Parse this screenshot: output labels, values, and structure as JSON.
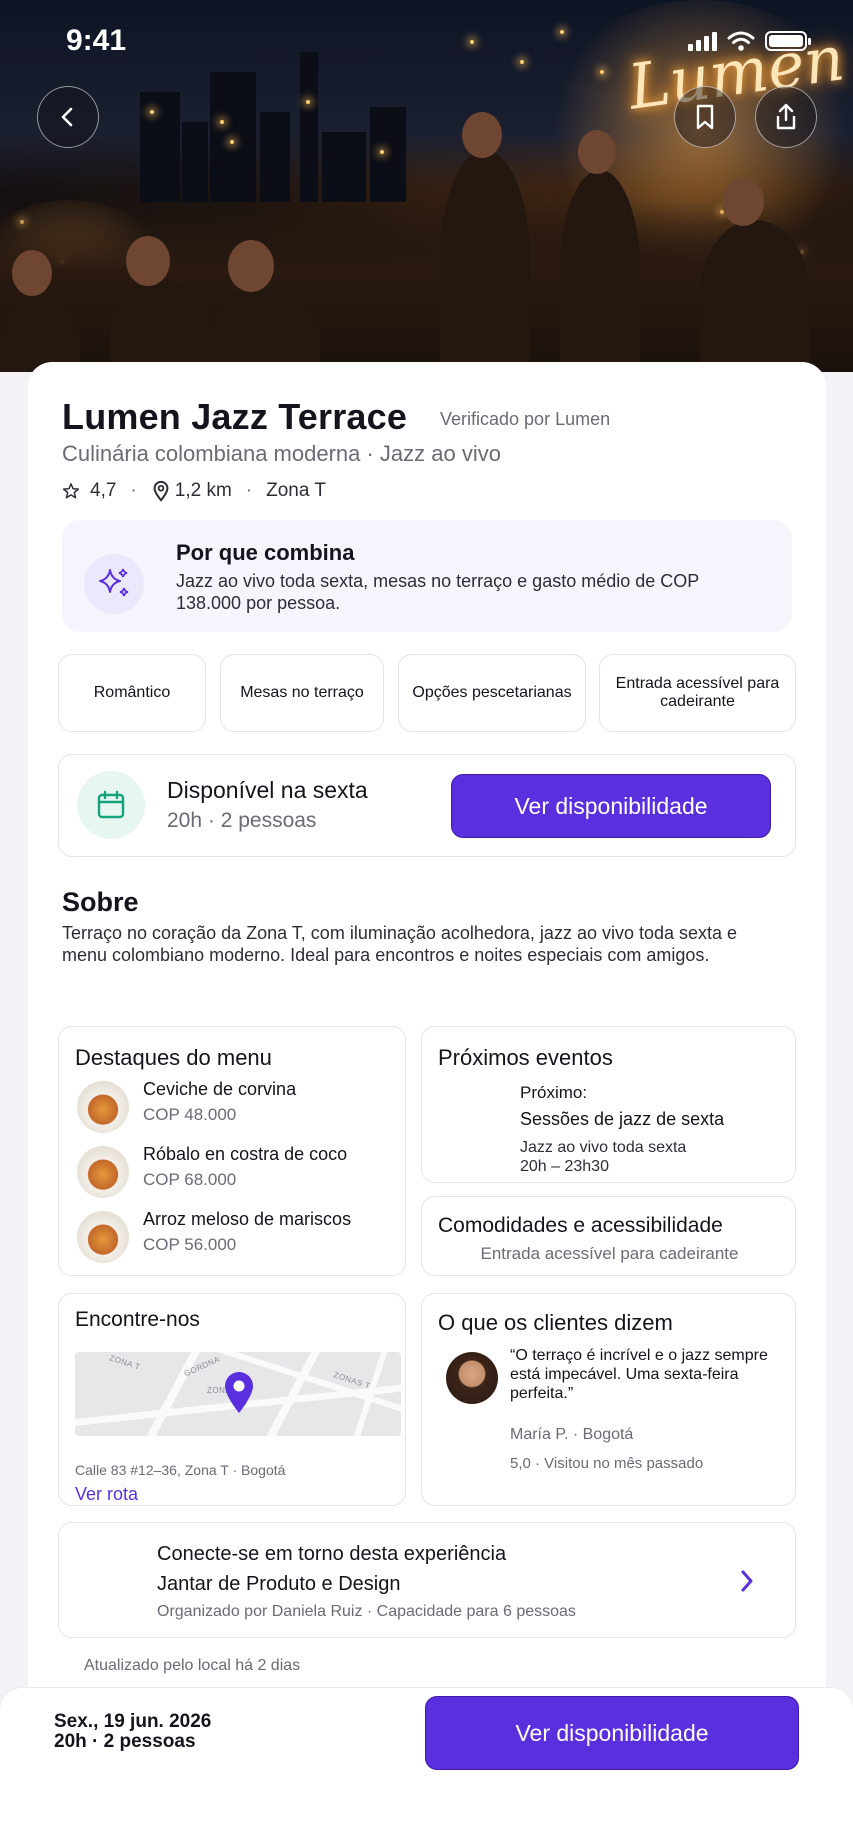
{
  "status": {
    "time": "9:41"
  },
  "hero": {
    "sign_text": "Lumen"
  },
  "venue": {
    "name": "Lumen Jazz Terrace",
    "verified": "Verificado por Lumen",
    "subtitle": "Culinária colombiana moderna · Jazz ao vivo",
    "rating": "4,7",
    "distance": "1,2 km",
    "area": "Zona T"
  },
  "why": {
    "title": "Por que combina",
    "text": "Jazz ao vivo toda sexta, mesas no terraço e gasto médio de COP 138.000 por pessoa."
  },
  "chips": [
    "Romântico",
    "Mesas no terraço",
    "Opções pescetarianas",
    "Entrada acessível para cadeirante"
  ],
  "availability": {
    "title": "Disponível na sexta",
    "subtitle": "20h · 2 pessoas",
    "button": "Ver disponibilidade"
  },
  "about": {
    "heading": "Sobre",
    "text": "Terraço no coração da Zona T, com iluminação acolhedora, jazz ao vivo toda sexta e menu colombiano moderno. Ideal para encontros e noites especiais com amigos."
  },
  "menu": {
    "heading": "Destaques do menu",
    "items": [
      {
        "name": "Ceviche de corvina",
        "price": "COP 48.000"
      },
      {
        "name": "Róbalo en costra de coco",
        "price": "COP 68.000"
      },
      {
        "name": "Arroz meloso de mariscos",
        "price": "COP 56.000"
      }
    ]
  },
  "events": {
    "heading": "Próximos eventos",
    "label": "Próximo:",
    "name": "Sessões de jazz de sexta",
    "desc": "Jazz ao vivo toda sexta",
    "time": "20h – 23h30"
  },
  "amenities": {
    "heading": "Comodidades e acessibilidade",
    "text": "Entrada acessível para cadeirante"
  },
  "find": {
    "heading": "Encontre-nos",
    "streets": [
      "ZONA T",
      "GORDNA",
      "ZONA T",
      "ZONAS T"
    ],
    "address": "Calle 83 #12–36, Zona T · Bogotá",
    "link": "Ver rota"
  },
  "reviews": {
    "heading": "O que os clientes dizem",
    "quote": "“O terraço é incrível e o jazz sempre está impecável. Uma sexta-feira perfeita.”",
    "author": "María P. · Bogotá",
    "meta": "5,0 · Visitou no mês passado"
  },
  "connect": {
    "title": "Conecte-se em torno desta experiência",
    "event": "Jantar de Produto e Design",
    "meta": "Organizado por Daniela Ruiz · Capacidade para 6 pessoas"
  },
  "updated": "Atualizado pelo local há 2 dias",
  "bottom": {
    "date": "Sex., 19 jun. 2026",
    "detail": "20h · 2 pessoas",
    "button": "Ver disponibilidade"
  },
  "colors": {
    "accent": "#5a2fde",
    "accent_soft": "#f6f4fd",
    "success_soft": "#e8f6f1"
  },
  "icons": [
    "back-icon",
    "bookmark-icon",
    "share-icon",
    "star-icon",
    "location-pin-icon",
    "sparkles-icon",
    "calendar-icon",
    "chevron-right-icon",
    "map-pin-icon"
  ]
}
